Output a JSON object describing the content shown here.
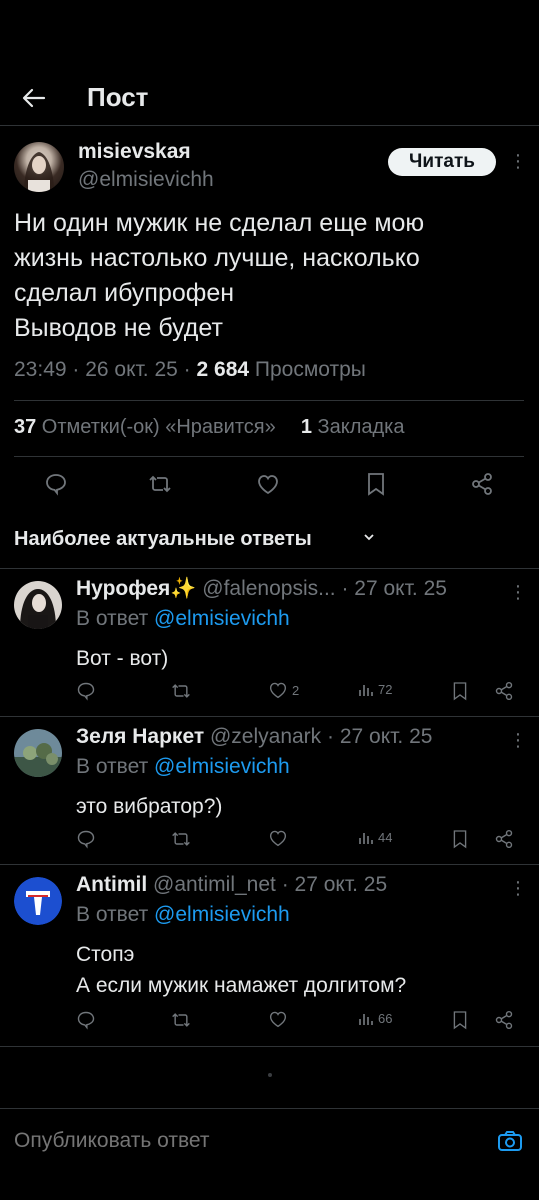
{
  "header": {
    "title": "Пост"
  },
  "post": {
    "author_name": "misievskaя",
    "author_handle": "@elmisievichh",
    "follow_label": "Читать",
    "text": "Ни один мужик не сделал еще мою\nжизнь настолько лучше, насколько\nсделал ибупрофен\nВыводов не будет",
    "time": "23:49 · 26 окт. 25 · ",
    "views_count": "2 684",
    "views_label": " Просмотры",
    "likes_count": "37",
    "likes_label": " Отметки(-ок) «Нравится»",
    "bookmarks_count": "1",
    "bookmarks_label": " Закладка"
  },
  "section": {
    "title": "Наиболее актуальные ответы"
  },
  "replies": [
    {
      "name": "Нурофея",
      "emoji": "✨",
      "handle": " @falenopsis... ",
      "date": "· 27 окт. 25",
      "reply_prefix": "В ответ ",
      "reply_to": "@elmisievichh",
      "text": "Вот - вот)",
      "likes": "2",
      "views": "72"
    },
    {
      "name": "Зеля Наркет",
      "emoji": "",
      "handle": " @zelyanark ",
      "date": "· 27 окт. 25",
      "reply_prefix": "В ответ ",
      "reply_to": "@elmisievichh",
      "text": "это вибратор?)",
      "likes": "",
      "views": "44"
    },
    {
      "name": "Antimil",
      "emoji": "",
      "handle": " @antimil_net ",
      "date": "· 27 окт. 25",
      "reply_prefix": "В ответ ",
      "reply_to": "@elmisievichh",
      "text": "Стопэ\nА если мужик намажет долгитом?",
      "likes": "",
      "views": "66"
    }
  ],
  "composer": {
    "placeholder": "Опубликовать ответ"
  },
  "colors": {
    "background": "#000000",
    "link": "#1d9bf0",
    "muted": "#71767b",
    "divider": "#2f3336"
  }
}
